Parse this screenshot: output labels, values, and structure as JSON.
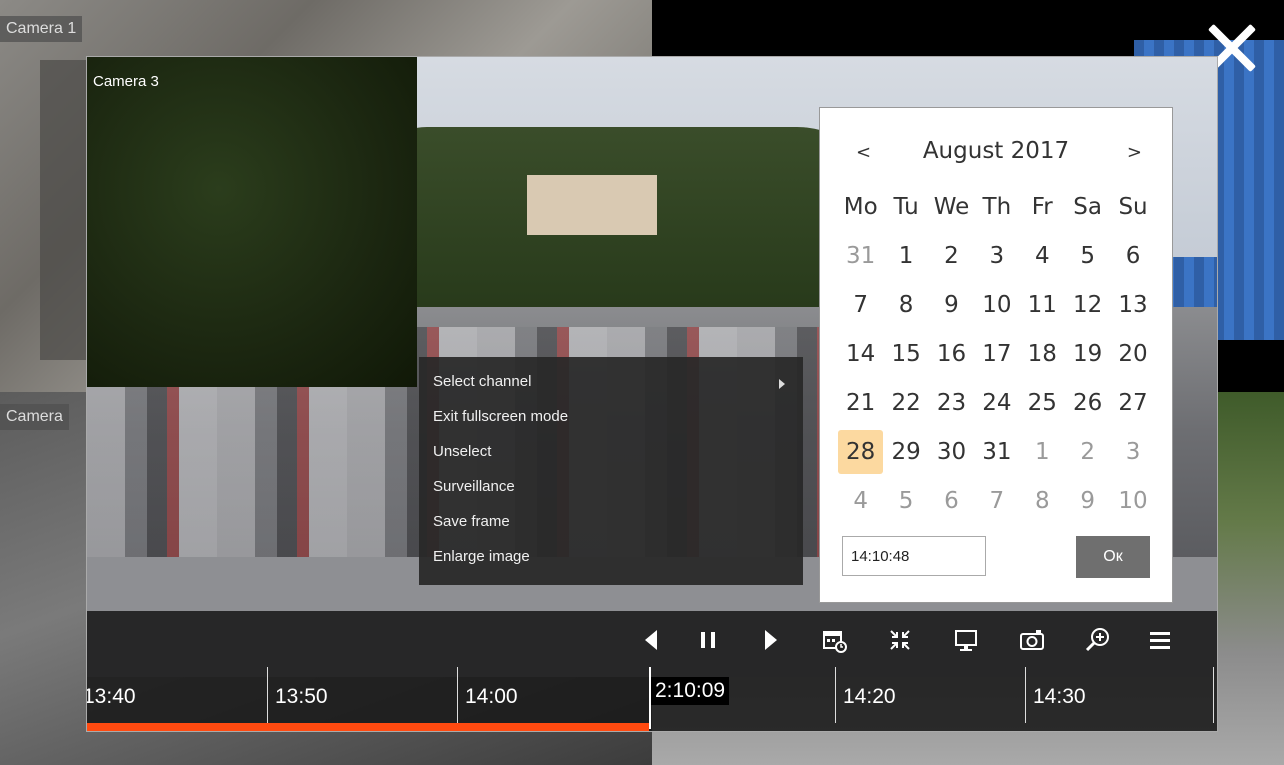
{
  "background_tiles": {
    "camera1_label": "Camera 1",
    "camera_partial_label": "Camera"
  },
  "fullscreen": {
    "camera_label": "Camera 3"
  },
  "context_menu": {
    "items": [
      {
        "label": "Select channel",
        "has_submenu": true
      },
      {
        "label": "Exit fullscreen mode"
      },
      {
        "label": "Unselect"
      },
      {
        "label": "Surveillance"
      },
      {
        "label": "Save frame"
      },
      {
        "label": "Enlarge image"
      }
    ]
  },
  "calendar": {
    "prev": "<",
    "next": ">",
    "title": "August 2017",
    "weekdays": [
      "Mo",
      "Tu",
      "We",
      "Th",
      "Fr",
      "Sa",
      "Su"
    ],
    "weeks": [
      [
        "31",
        "1",
        "2",
        "3",
        "4",
        "5",
        "6"
      ],
      [
        "7",
        "8",
        "9",
        "10",
        "11",
        "12",
        "13"
      ],
      [
        "14",
        "15",
        "16",
        "17",
        "18",
        "19",
        "20"
      ],
      [
        "21",
        "22",
        "23",
        "24",
        "25",
        "26",
        "27"
      ],
      [
        "28",
        "29",
        "30",
        "31",
        "1",
        "2",
        "3"
      ],
      [
        "4",
        "5",
        "6",
        "7",
        "8",
        "9",
        "10"
      ]
    ],
    "selected_day": "28",
    "time_value": "14:10:48",
    "ok_label": "Ок"
  },
  "toolbar": {
    "icons": [
      "prev-frame-icon",
      "pause-icon",
      "next-frame-icon",
      "calendar-icon",
      "exit-fullscreen-icon",
      "monitor-icon",
      "camera-snapshot-icon",
      "zoom-in-icon",
      "menu-icon"
    ]
  },
  "timeline": {
    "tick_labels": [
      "13:40",
      "13:50",
      "14:00",
      "14:20",
      "14:30"
    ],
    "current_time": "2:10:09",
    "progress_fraction": 0.497
  },
  "colors": {
    "progress": "#ff4a10",
    "selected_day": "#fcd9a0",
    "ok_button": "#6f6f6f"
  }
}
